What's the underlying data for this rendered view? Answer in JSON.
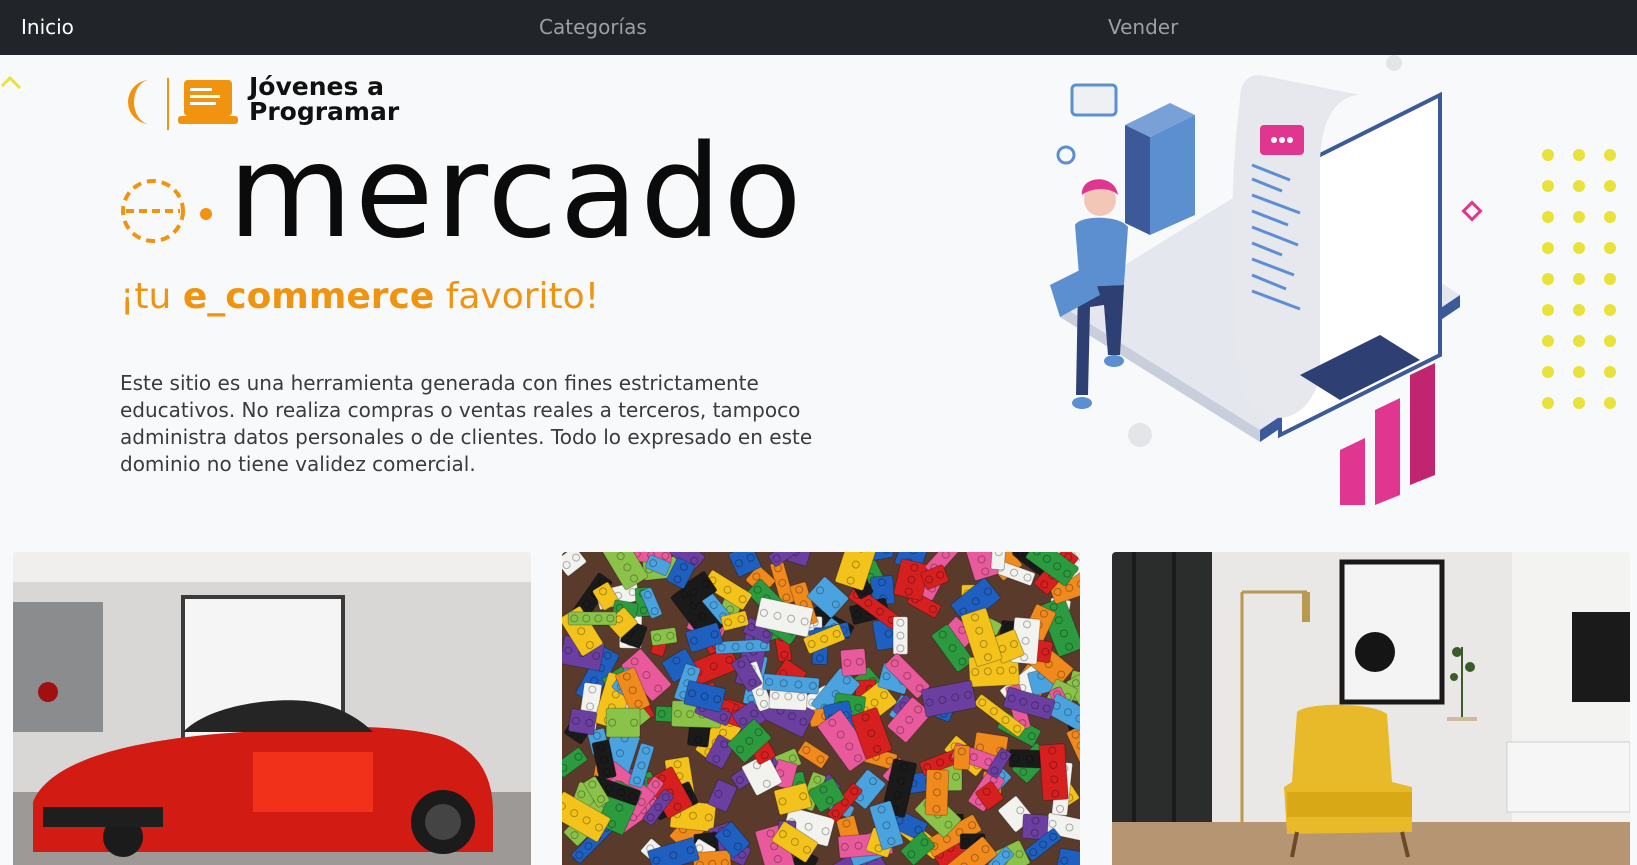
{
  "nav": {
    "items": [
      {
        "label": "Inicio",
        "active": true
      },
      {
        "label": "Categorías",
        "active": false
      },
      {
        "label": "Vender",
        "active": false
      }
    ]
  },
  "brand": {
    "name": "Jóvenes a\nProgramar",
    "logo_icon": "laptop-icon",
    "accent_color": "#f0940f"
  },
  "hero": {
    "wordmark": "mercado",
    "tagline_prefix": "¡tu ",
    "tagline_bold": "e_commerce",
    "tagline_suffix": " favorito!",
    "disclaimer": "Este sitio es una herramienta generada con fines estrictamente educativos. No realiza compras o ventas reales a terceros, tampoco administra datos personales o de clientes. Todo lo expresado en este dominio no tiene validez comercial."
  },
  "cards": [
    {
      "image": "red-sports-car-photo"
    },
    {
      "image": "lego-bricks-photo"
    },
    {
      "image": "yellow-armchair-livingroom-photo"
    }
  ],
  "colors": {
    "nav_bg": "#212529",
    "accent": "#f0940f",
    "page_bg": "#f8f9fa",
    "yellow_dots": "#e8e23a",
    "magenta": "#e0368f",
    "blue": "#3c5a99"
  }
}
